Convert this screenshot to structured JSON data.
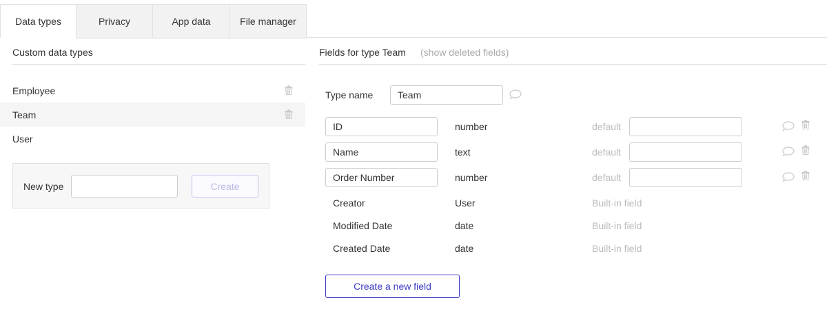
{
  "tabs": [
    {
      "label": "Data types",
      "active": true
    },
    {
      "label": "Privacy",
      "active": false
    },
    {
      "label": "App data",
      "active": false
    },
    {
      "label": "File manager",
      "active": false
    }
  ],
  "left": {
    "title": "Custom data types",
    "types": [
      {
        "label": "Employee",
        "deletable": true
      },
      {
        "label": "Team",
        "deletable": true,
        "selected": true
      },
      {
        "label": "User",
        "deletable": false
      }
    ],
    "new_type": {
      "label": "New type",
      "value": "",
      "create_label": "Create"
    }
  },
  "right": {
    "title": "Fields for type Team",
    "show_deleted": "(show deleted fields)",
    "type_name_label": "Type name",
    "type_name_value": "Team",
    "custom_fields": [
      {
        "name": "ID",
        "type": "number",
        "default_label": "default",
        "default_value": ""
      },
      {
        "name": "Name",
        "type": "text",
        "default_label": "default",
        "default_value": ""
      },
      {
        "name": "Order Number",
        "type": "number",
        "default_label": "default",
        "default_value": ""
      }
    ],
    "builtin_fields": [
      {
        "name": "Creator",
        "type": "User",
        "note": "Built-in field"
      },
      {
        "name": "Modified Date",
        "type": "date",
        "note": "Built-in field"
      },
      {
        "name": "Created Date",
        "type": "date",
        "note": "Built-in field"
      }
    ],
    "new_field_label": "Create a new field"
  },
  "colors": {
    "accent": "#3a3ac4",
    "accent_disabled": "#b8b8e3",
    "muted": "#bbbbbb",
    "border": "#e1e1e1",
    "icon": "#c8c8c8"
  }
}
